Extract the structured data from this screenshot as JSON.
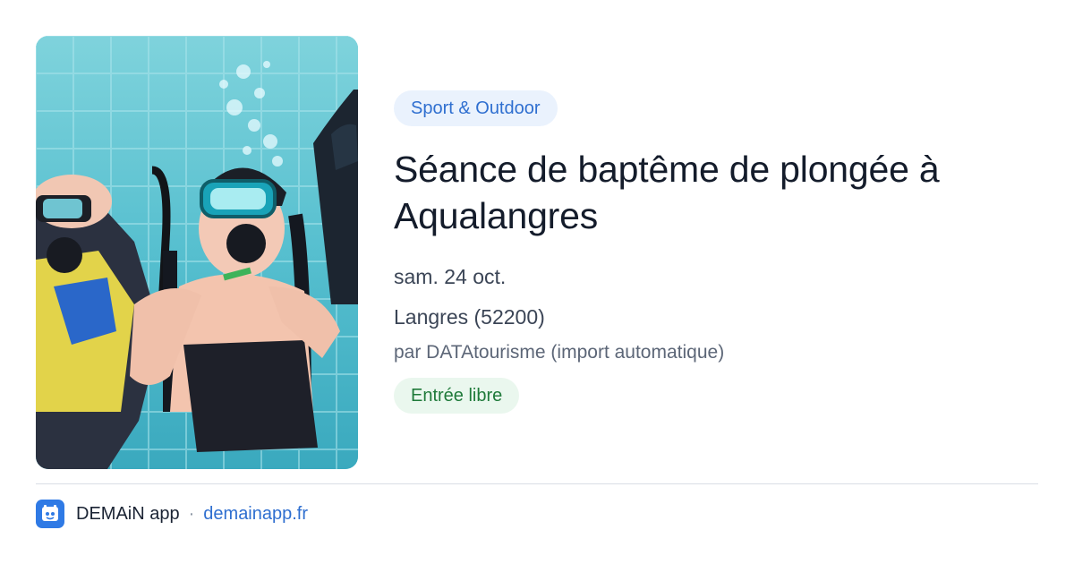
{
  "event": {
    "category": "Sport & Outdoor",
    "title": "Séance de baptême de plongée à Aqualangres",
    "date": "sam. 24 oct.",
    "location": "Langres (52200)",
    "source": "par DATAtourisme (import automatique)",
    "price": "Entrée libre",
    "image_icon": "diving-photo"
  },
  "footer": {
    "app_name": "DEMAiN app",
    "separator": "·",
    "link": "demainapp.fr",
    "logo_icon": "demain-logo-icon"
  },
  "colors": {
    "accent_blue": "#2f6fd0",
    "category_bg": "#eaf2fd",
    "price_green": "#1f7a3a",
    "price_bg": "#eaf7ee",
    "pool_water": "#5cc3d3"
  }
}
